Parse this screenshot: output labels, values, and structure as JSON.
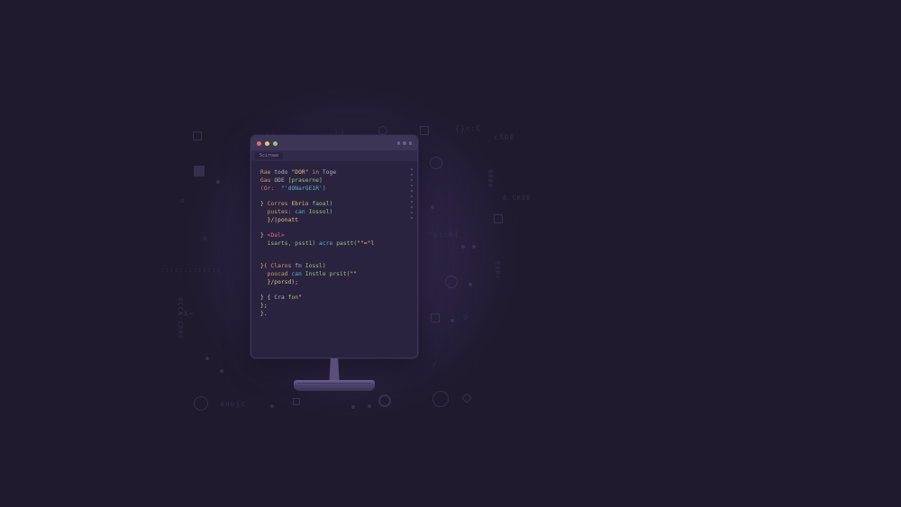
{
  "colors": {
    "background": "#1f1a2e",
    "monitor": "#2a2340",
    "accent": "#6b5f8f"
  },
  "tab_label": "Scirowe",
  "code": {
    "l1": {
      "a": "Rae",
      "b": "todo",
      "c": "\"DOR\"",
      "d": "in",
      "e": "Toge"
    },
    "l2": {
      "a": "Gau",
      "b": "ODE",
      "c": "[praserne]"
    },
    "l3": {
      "a": "(Or:",
      "b": "\"'dONarGE1R')"
    },
    "l4": {
      "a": "}",
      "b": "Corres",
      "c": "Ebrio",
      "d": "faoal)"
    },
    "l5": {
      "a": "pustes:",
      "b": "can",
      "c": "Iossol)"
    },
    "l6": {
      "a": "}/|ponatt"
    },
    "l7": {
      "a": "}",
      "b": "<Dal>"
    },
    "l8": {
      "a": "isarts,",
      "b": "psst1)",
      "c": "acre",
      "d": "pastt(",
      "e": "\"\"=\"l"
    },
    "l9": {
      "a": "}(",
      "b": "Claros",
      "c": "fn",
      "d": "Iossl)"
    },
    "l10": {
      "a": "poocad",
      "b": "can",
      "c": "Instle",
      "d": "prsit(",
      "e": "\"\""
    },
    "l11": {
      "a": "}/porsd);"
    },
    "l12": {
      "a": "} {",
      "b": "Cra",
      "c": "fon",
      "d": "\""
    },
    "l13": {
      "a": "};"
    },
    "l14": {
      "a": "}."
    }
  }
}
